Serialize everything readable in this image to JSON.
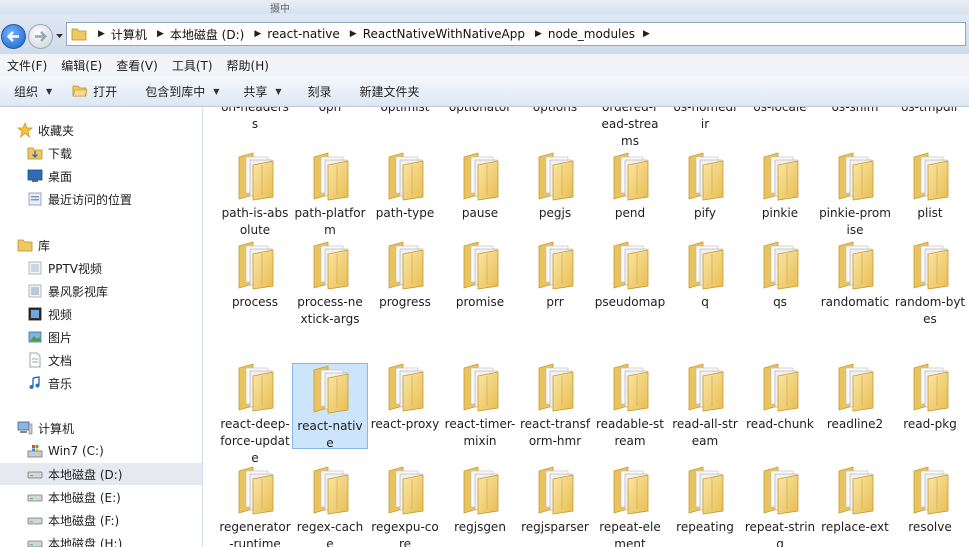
{
  "window": {
    "tab_hint": "摄中"
  },
  "address": {
    "crumbs": [
      "计算机",
      "本地磁盘 (D:)",
      "react-native",
      "ReactNativeWithNativeApp",
      "node_modules"
    ]
  },
  "menubar": [
    "文件(F)",
    "编辑(E)",
    "查看(V)",
    "工具(T)",
    "帮助(H)"
  ],
  "toolbar": {
    "organize": "组织",
    "open": "打开",
    "include": "包含到库中",
    "share": "共享",
    "burn": "刻录",
    "new_folder": "新建文件夹"
  },
  "sidebar": {
    "favorites": "收藏夹",
    "downloads": "下载",
    "desktop": "桌面",
    "recent": "最近访问的位置",
    "libraries": "库",
    "pptv": "PPTV视频",
    "baofeng": "暴风影视库",
    "videos": "视频",
    "pictures": "图片",
    "documents": "文档",
    "music": "音乐",
    "computer": "计算机",
    "drives": [
      "Win7 (C:)",
      "本地磁盘 (D:)",
      "本地磁盘 (E:)",
      "本地磁盘 (F:)",
      "本地磁盘 (H:)"
    ]
  },
  "partial_top": [
    {
      "line1": "on-headers",
      "line2": "s"
    },
    {
      "line1": "opn",
      "line2": ""
    },
    {
      "line1": "optimist",
      "line2": ""
    },
    {
      "line1": "optionator",
      "line2": ""
    },
    {
      "line1": "options",
      "line2": ""
    },
    {
      "line1": "ordered-r",
      "line2": "ead-strea",
      "line3": "ms"
    },
    {
      "line1": "os-homedi",
      "line2": "ir"
    },
    {
      "line1": "os-locale",
      "line2": ""
    },
    {
      "line1": "os-shim",
      "line2": ""
    },
    {
      "line1": "os-tmpdir",
      "line2": ""
    }
  ],
  "rows": [
    [
      "path-is-absolute",
      "path-platform",
      "path-type",
      "pause",
      "pegjs",
      "pend",
      "pify",
      "pinkie",
      "pinkie-promise",
      "plist"
    ],
    [
      "process",
      "process-nextick-args",
      "progress",
      "promise",
      "prr",
      "pseudomap",
      "q",
      "qs",
      "randomatic",
      "random-bytes"
    ],
    [
      "react-deep-force-update",
      "react-native",
      "react-proxy",
      "react-timer-mixin",
      "react-transform-hmr",
      "readable-stream",
      "read-all-stream",
      "read-chunk",
      "readline2",
      "read-pkg"
    ],
    [
      "regenerator-runtime",
      "regex-cache",
      "regexpu-core",
      "regjsgen",
      "regjsparser",
      "repeat-element",
      "repeating",
      "repeat-string",
      "replace-ext",
      "resolve"
    ]
  ],
  "selected_item": "react-native",
  "colors": {
    "accent": "#cde5fb",
    "folder": "#f2d27a"
  }
}
